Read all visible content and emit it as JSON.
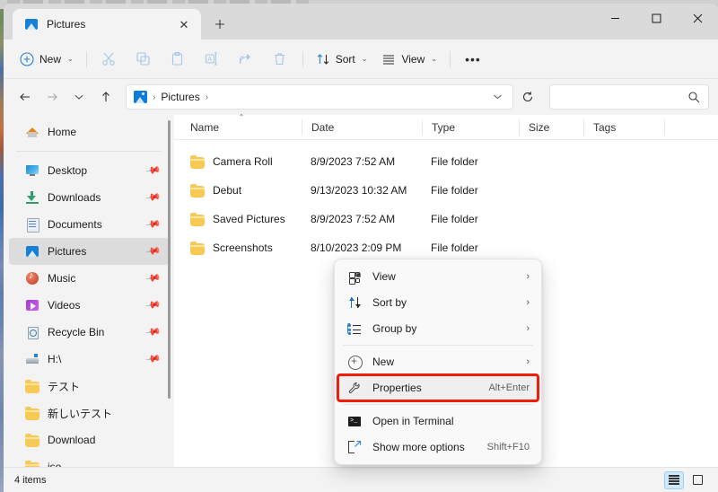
{
  "window": {
    "tab_title": "Pictures",
    "tab_close_icon": "close-icon",
    "new_tab_icon": "plus-icon",
    "minimize_label": "–",
    "maximize_label": "☐",
    "close_label": "✕"
  },
  "commandbar": {
    "new_label": "New",
    "new_chevron": "⌄",
    "cut_icon": "scissors-icon",
    "copy_icon": "copy-icon",
    "paste_icon": "paste-icon",
    "rename_icon": "rename-icon",
    "share_icon": "share-icon",
    "delete_icon": "trash-icon",
    "sort_label": "Sort",
    "sort_chevron": "⌄",
    "view_label": "View",
    "view_chevron": "⌄",
    "more_label": "•••"
  },
  "addressbar": {
    "back_icon": "←",
    "forward_icon": "→",
    "recent_icon": "⌄",
    "up_icon": "↑",
    "crumb_icon": "pictures-icon",
    "crumb_sep_1": "›",
    "crumb_label": "Pictures",
    "crumb_sep_2": "›",
    "dropdown_icon": "⌄",
    "refresh_icon": "⟳",
    "search_value": "",
    "search_placeholder": "",
    "search_icon": "⚲"
  },
  "sidebar": {
    "home": {
      "label": "Home",
      "icon": "home-icon"
    },
    "items": [
      {
        "label": "Desktop",
        "icon": "desktop-icon",
        "pinned": true,
        "selected": false
      },
      {
        "label": "Downloads",
        "icon": "downloads-icon",
        "pinned": true,
        "selected": false
      },
      {
        "label": "Documents",
        "icon": "documents-icon",
        "pinned": true,
        "selected": false
      },
      {
        "label": "Pictures",
        "icon": "pictures-icon",
        "pinned": true,
        "selected": true
      },
      {
        "label": "Music",
        "icon": "music-icon",
        "pinned": true,
        "selected": false
      },
      {
        "label": "Videos",
        "icon": "videos-icon",
        "pinned": true,
        "selected": false
      },
      {
        "label": "Recycle Bin",
        "icon": "recycle-bin-icon",
        "pinned": true,
        "selected": false
      },
      {
        "label": "H:\\",
        "icon": "drive-icon",
        "pinned": true,
        "selected": false
      },
      {
        "label": "テスト",
        "icon": "folder-icon",
        "pinned": false,
        "selected": false
      },
      {
        "label": "新しいテスト",
        "icon": "folder-icon",
        "pinned": false,
        "selected": false
      },
      {
        "label": "Download",
        "icon": "folder-icon",
        "pinned": false,
        "selected": false
      },
      {
        "label": "iso",
        "icon": "folder-icon",
        "pinned": false,
        "selected": false
      }
    ],
    "pin_icon": "📌"
  },
  "filelist": {
    "columns": [
      {
        "label": "Name",
        "sorted": true,
        "sort_caret": "⌃"
      },
      {
        "label": "Date",
        "sorted": false
      },
      {
        "label": "Type",
        "sorted": false
      },
      {
        "label": "Size",
        "sorted": false
      },
      {
        "label": "Tags",
        "sorted": false
      }
    ],
    "rows": [
      {
        "icon": "folder-icon",
        "name": "Camera Roll",
        "date": "8/9/2023 7:52 AM",
        "type": "File folder",
        "size": "",
        "tags": ""
      },
      {
        "icon": "folder-icon",
        "name": "Debut",
        "date": "9/13/2023 10:32 AM",
        "type": "File folder",
        "size": "",
        "tags": ""
      },
      {
        "icon": "folder-icon",
        "name": "Saved Pictures",
        "date": "8/9/2023 7:52 AM",
        "type": "File folder",
        "size": "",
        "tags": ""
      },
      {
        "icon": "folder-icon",
        "name": "Screenshots",
        "date": "8/10/2023 2:09 PM",
        "type": "File folder",
        "size": "",
        "tags": ""
      }
    ]
  },
  "context_menu": {
    "items": [
      {
        "id": "view",
        "label": "View",
        "icon": "view-grid-icon",
        "accel": "",
        "submenu_arrow": "›",
        "highlighted": false
      },
      {
        "id": "sort-by",
        "label": "Sort by",
        "icon": "sort-icon",
        "accel": "",
        "submenu_arrow": "›",
        "highlighted": false
      },
      {
        "id": "group-by",
        "label": "Group by",
        "icon": "group-icon",
        "accel": "",
        "submenu_arrow": "›",
        "highlighted": false
      },
      {
        "id": "divider-1",
        "type": "divider"
      },
      {
        "id": "new",
        "label": "New",
        "icon": "plus-circle-icon",
        "accel": "",
        "submenu_arrow": "›",
        "highlighted": false
      },
      {
        "id": "properties",
        "label": "Properties",
        "icon": "wrench-icon",
        "accel": "Alt+Enter",
        "submenu_arrow": "",
        "highlighted": true
      },
      {
        "id": "divider-2",
        "type": "divider"
      },
      {
        "id": "open-terminal",
        "label": "Open in Terminal",
        "icon": "terminal-icon",
        "accel": "",
        "submenu_arrow": "",
        "highlighted": false
      },
      {
        "id": "show-more",
        "label": "Show more options",
        "icon": "expand-icon",
        "accel": "Shift+F10",
        "submenu_arrow": "",
        "highlighted": false
      }
    ],
    "highlight_color": "#f21c0a"
  },
  "statusbar": {
    "item_count": "4 items",
    "details_view_icon": "details-view-icon",
    "tiles_view_icon": "tiles-view-icon",
    "active_view": "details"
  }
}
